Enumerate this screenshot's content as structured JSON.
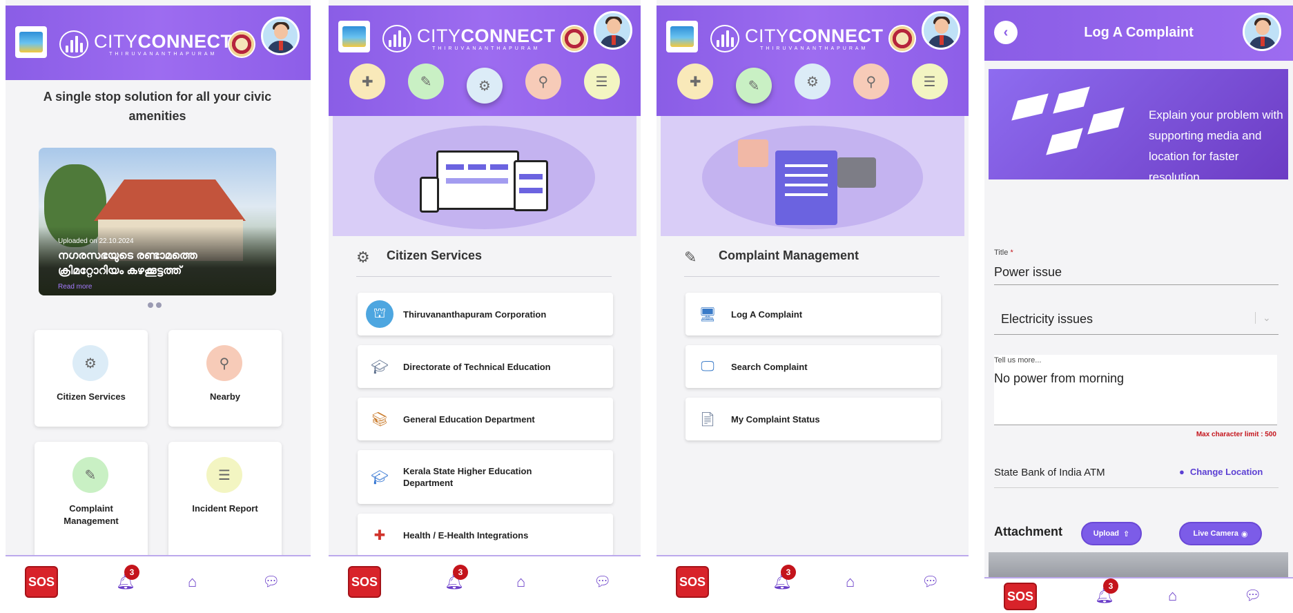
{
  "brand": {
    "name_light": "CITY",
    "name_bold": "CONNECT",
    "city": "THIRUVANANTHAPURAM"
  },
  "screen1": {
    "tagline": "A single stop solution for all your civic amenities",
    "banner": {
      "date": "Uploaded on 22.10.2024",
      "title": "നഗരസഭയുടെ രണ്ടാമത്തെ ക്രിമറ്റോറിയം കഴക്കൂട്ടത്ത്",
      "more": "Read more"
    },
    "tiles": [
      {
        "label": "Citizen Services",
        "icon": "user-gear-icon",
        "color": "#dcecf7"
      },
      {
        "label": "Nearby",
        "icon": "map-user-icon",
        "color": "#f7cbb8"
      },
      {
        "label": "Complaint Management",
        "icon": "edit-doc-icon",
        "color": "#c9f0c4"
      },
      {
        "label": "Incident Report",
        "icon": "doc-icon",
        "color": "#f3f5c2"
      }
    ]
  },
  "nav_icons": [
    {
      "name": "ambulance-icon",
      "color": "#f9e9b9"
    },
    {
      "name": "edit-doc-icon",
      "color": "#c9f0c4"
    },
    {
      "name": "user-gear-icon",
      "color": "#dcecf7"
    },
    {
      "name": "map-user-icon",
      "color": "#f7cbb8"
    },
    {
      "name": "doc-icon",
      "color": "#f3f5c2"
    }
  ],
  "screen2": {
    "section_title": "Citizen Services",
    "items": [
      {
        "label": "Thiruvananthapuram Corporation",
        "icon": "corporation-icon"
      },
      {
        "label": "Directorate of Technical Education",
        "icon": "technical-edu-icon"
      },
      {
        "label": "General Education Department",
        "icon": "books-icon"
      },
      {
        "label": "Kerala State Higher Education Department",
        "icon": "graduation-cap-icon"
      },
      {
        "label": "Health / E-Health Integrations",
        "icon": "health-icon"
      }
    ]
  },
  "screen3": {
    "section_title": "Complaint Management",
    "items": [
      {
        "label": "Log A Complaint",
        "icon": "log-complaint-icon"
      },
      {
        "label": "Search Complaint",
        "icon": "search-complaint-icon"
      },
      {
        "label": "My Complaint Status",
        "icon": "complaint-status-icon"
      }
    ]
  },
  "screen4": {
    "title": "Log A Complaint",
    "banner_text": "Explain your problem with supporting media and location for faster resolution.",
    "title_label": "Title",
    "title_required": "*",
    "title_value": "Power issue",
    "category_value": "Electricity issues",
    "desc_label": "Tell us more...",
    "desc_value": "No power from morning",
    "max_limit": "Max character limit : 500",
    "location": "State Bank of India ATM",
    "change_location": "Change Location",
    "attachment_label": "Attachment",
    "upload_label": "Upload",
    "camera_label": "Live Camera"
  },
  "bottom_nav": {
    "sos": "SOS",
    "notification_count": "3"
  },
  "colors": {
    "header": "#8a5de6",
    "accent": "#5b3fd3",
    "sos": "#d8232a"
  }
}
